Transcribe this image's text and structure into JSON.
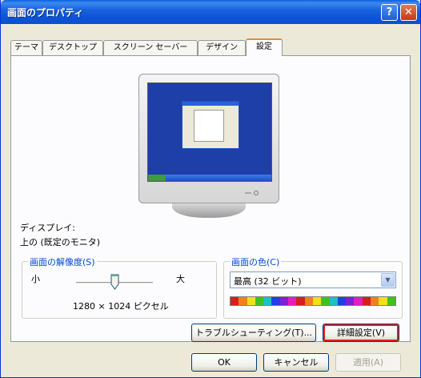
{
  "window": {
    "title": "画面のプロパティ",
    "help_glyph": "?",
    "close_glyph": "✕"
  },
  "tabs": [
    {
      "label": "テーマ"
    },
    {
      "label": "デスクトップ"
    },
    {
      "label": "スクリーン セーバー"
    },
    {
      "label": "デザイン"
    },
    {
      "label": "設定",
      "active": true
    }
  ],
  "display": {
    "label": "ディスプレイ:",
    "value": "上の (既定のモニタ)"
  },
  "resolution": {
    "group_title": "画面の解像度(S)",
    "min_label": "小",
    "max_label": "大",
    "value_text": "1280 × 1024 ピクセル"
  },
  "color_quality": {
    "group_title": "画面の色(C)",
    "selected": "最高 (32 ビット)",
    "swatches": [
      "#d02020",
      "#f08020",
      "#f0e020",
      "#40c020",
      "#20c0c0",
      "#2040e0",
      "#8020d0",
      "#e020c0",
      "#d02020",
      "#f08020",
      "#f0e020",
      "#40c020",
      "#20c0c0",
      "#2040e0",
      "#8020d0",
      "#e020c0",
      "#d02020",
      "#f08020",
      "#f0e020",
      "#40c020"
    ]
  },
  "buttons": {
    "troubleshoot": "トラブルシューティング(T)...",
    "advanced": "詳細設定(V)",
    "ok": "OK",
    "cancel": "キャンセル",
    "apply": "適用(A)"
  },
  "colors": {
    "titlebar": "#0a5fdc",
    "panel": "#fcfcfe",
    "focus_outline": "#e02020"
  }
}
